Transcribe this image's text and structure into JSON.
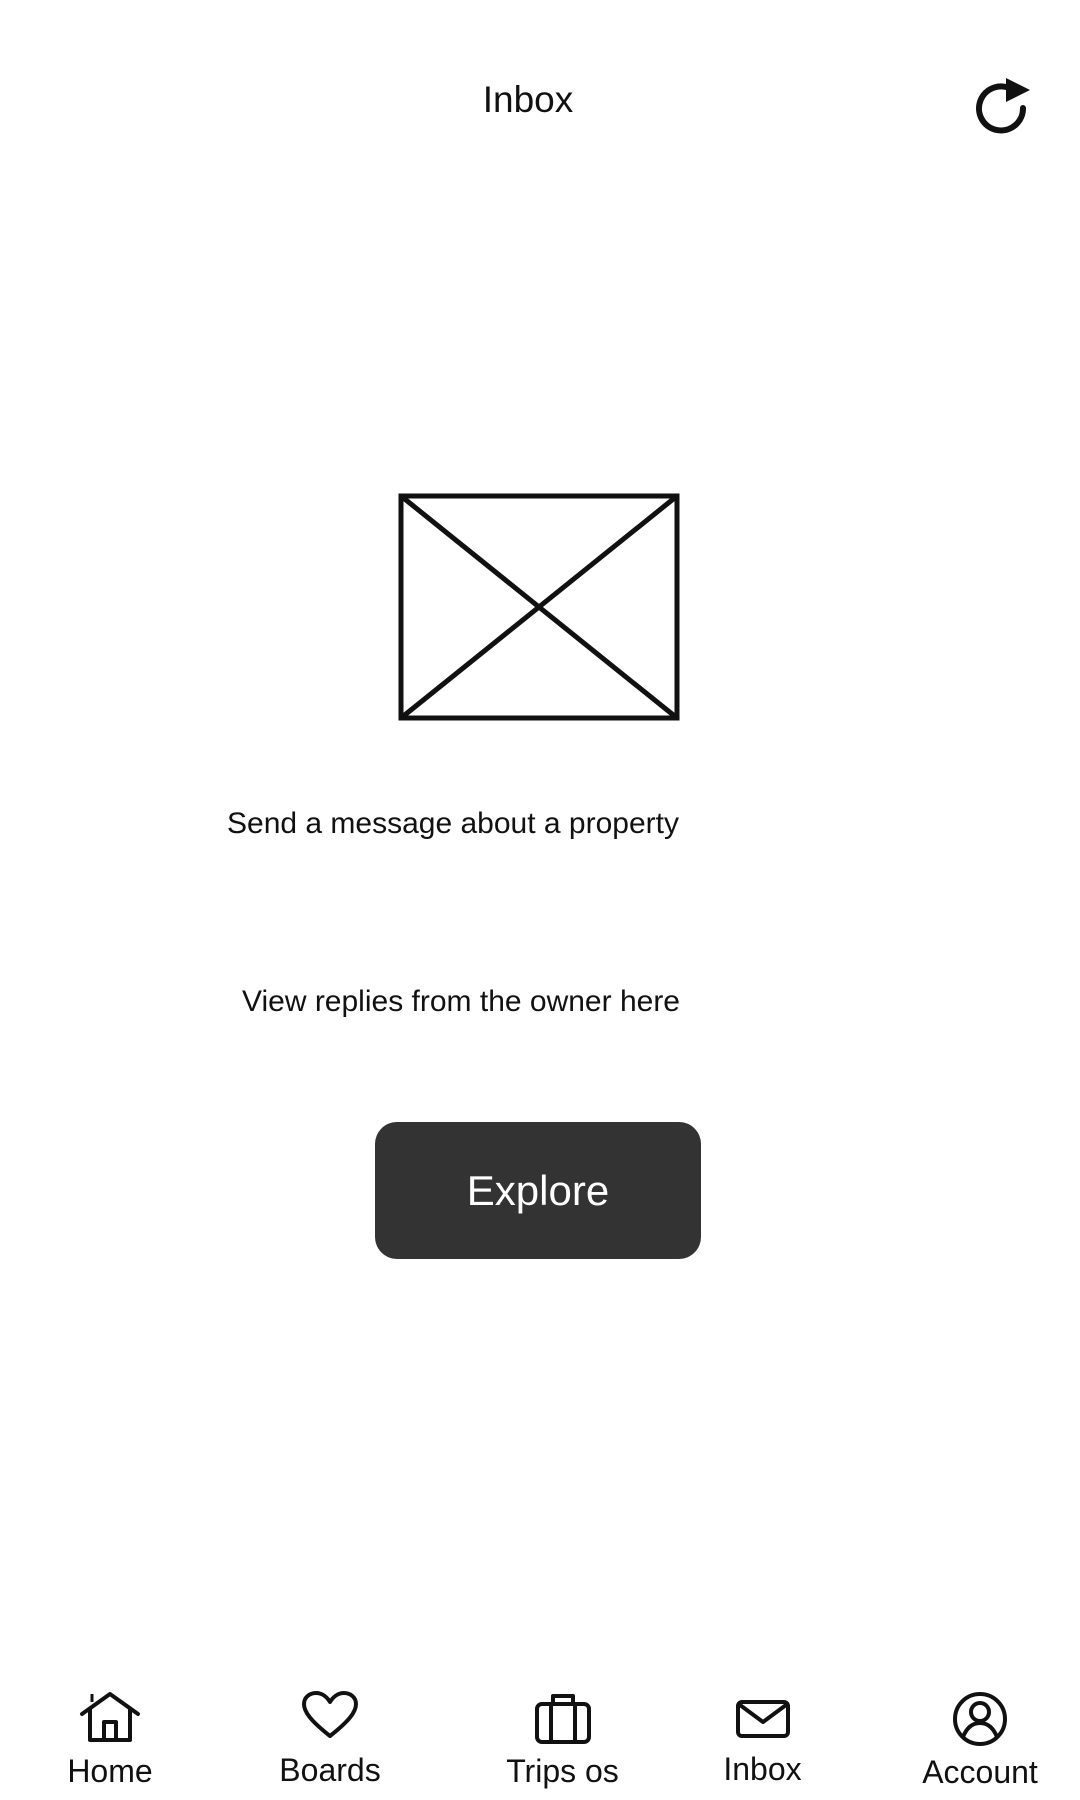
{
  "header": {
    "title": "Inbox",
    "refresh_icon": "refresh-icon"
  },
  "empty_state": {
    "image_icon": "image-placeholder-icon",
    "line_1": "Send a message about a property",
    "line_2": "View replies from the owner here",
    "button_label": "Explore"
  },
  "nav": {
    "items": [
      {
        "label": "Home",
        "icon": "home-icon"
      },
      {
        "label": "Boards",
        "icon": "heart-icon"
      },
      {
        "label": "Trips os",
        "icon": "briefcase-icon"
      },
      {
        "label": "Inbox",
        "icon": "mail-icon"
      },
      {
        "label": "Account",
        "icon": "account-icon"
      }
    ]
  }
}
